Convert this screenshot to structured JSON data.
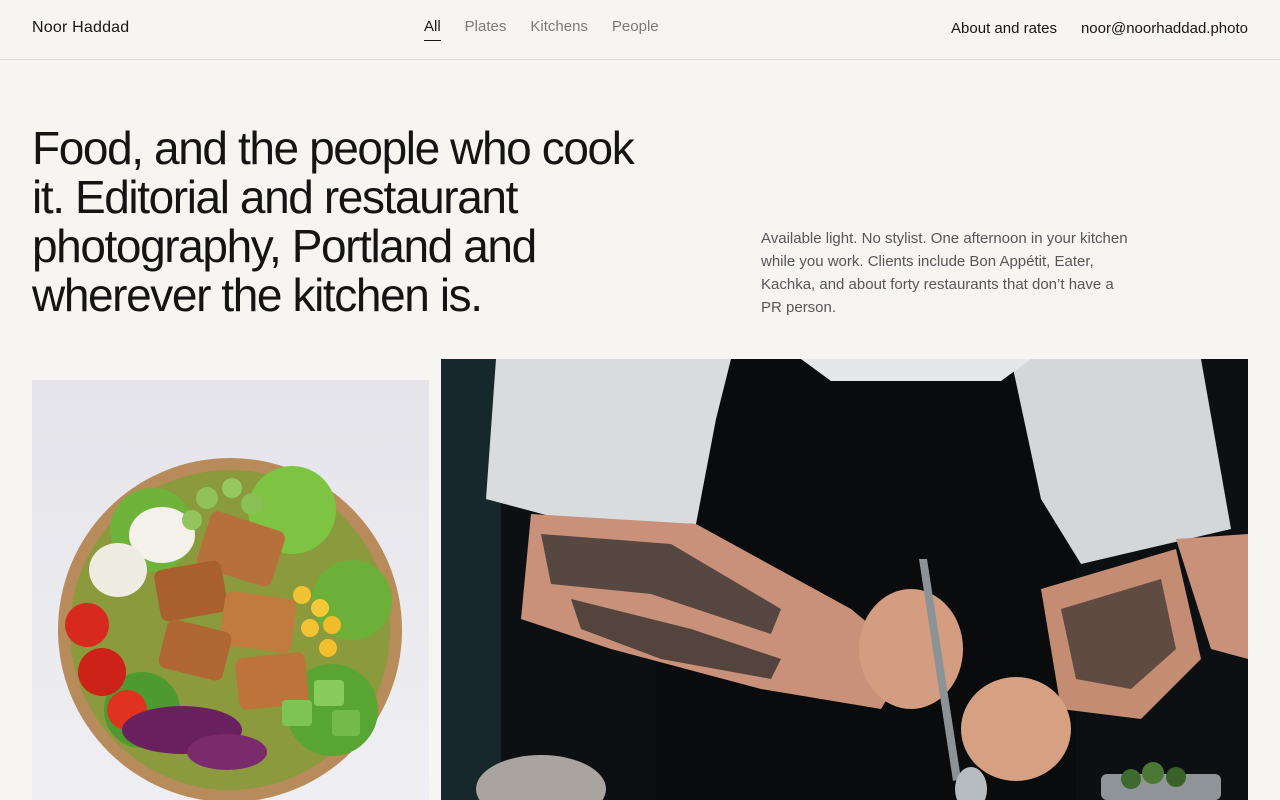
{
  "header": {
    "brand": "Noor Haddad",
    "filters": [
      {
        "label": "All",
        "active": true
      },
      {
        "label": "Plates",
        "active": false
      },
      {
        "label": "Kitchens",
        "active": false
      },
      {
        "label": "People",
        "active": false
      }
    ],
    "about_link": "About and rates",
    "email_link": "noor@noorhaddad.photo"
  },
  "hero": {
    "headline": "Food, and the people who cook it. Editorial and restaurant photography, Portland and wherever the kitchen is.",
    "intro": "Available light. No stylist. One afternoon in your kitchen while you work. Clients include Bon Appétit, Eater, Kachka, and about forty restaurants that don’t have a PR person."
  },
  "gallery": {
    "photos": [
      {
        "subject": "salad-bowl-photo"
      },
      {
        "subject": "tattooed-chef-plating-photo"
      }
    ]
  },
  "colors": {
    "background": "#f6f5f2",
    "text": "#161616",
    "muted": "#7b7a76",
    "rule": "#dedcd7"
  }
}
